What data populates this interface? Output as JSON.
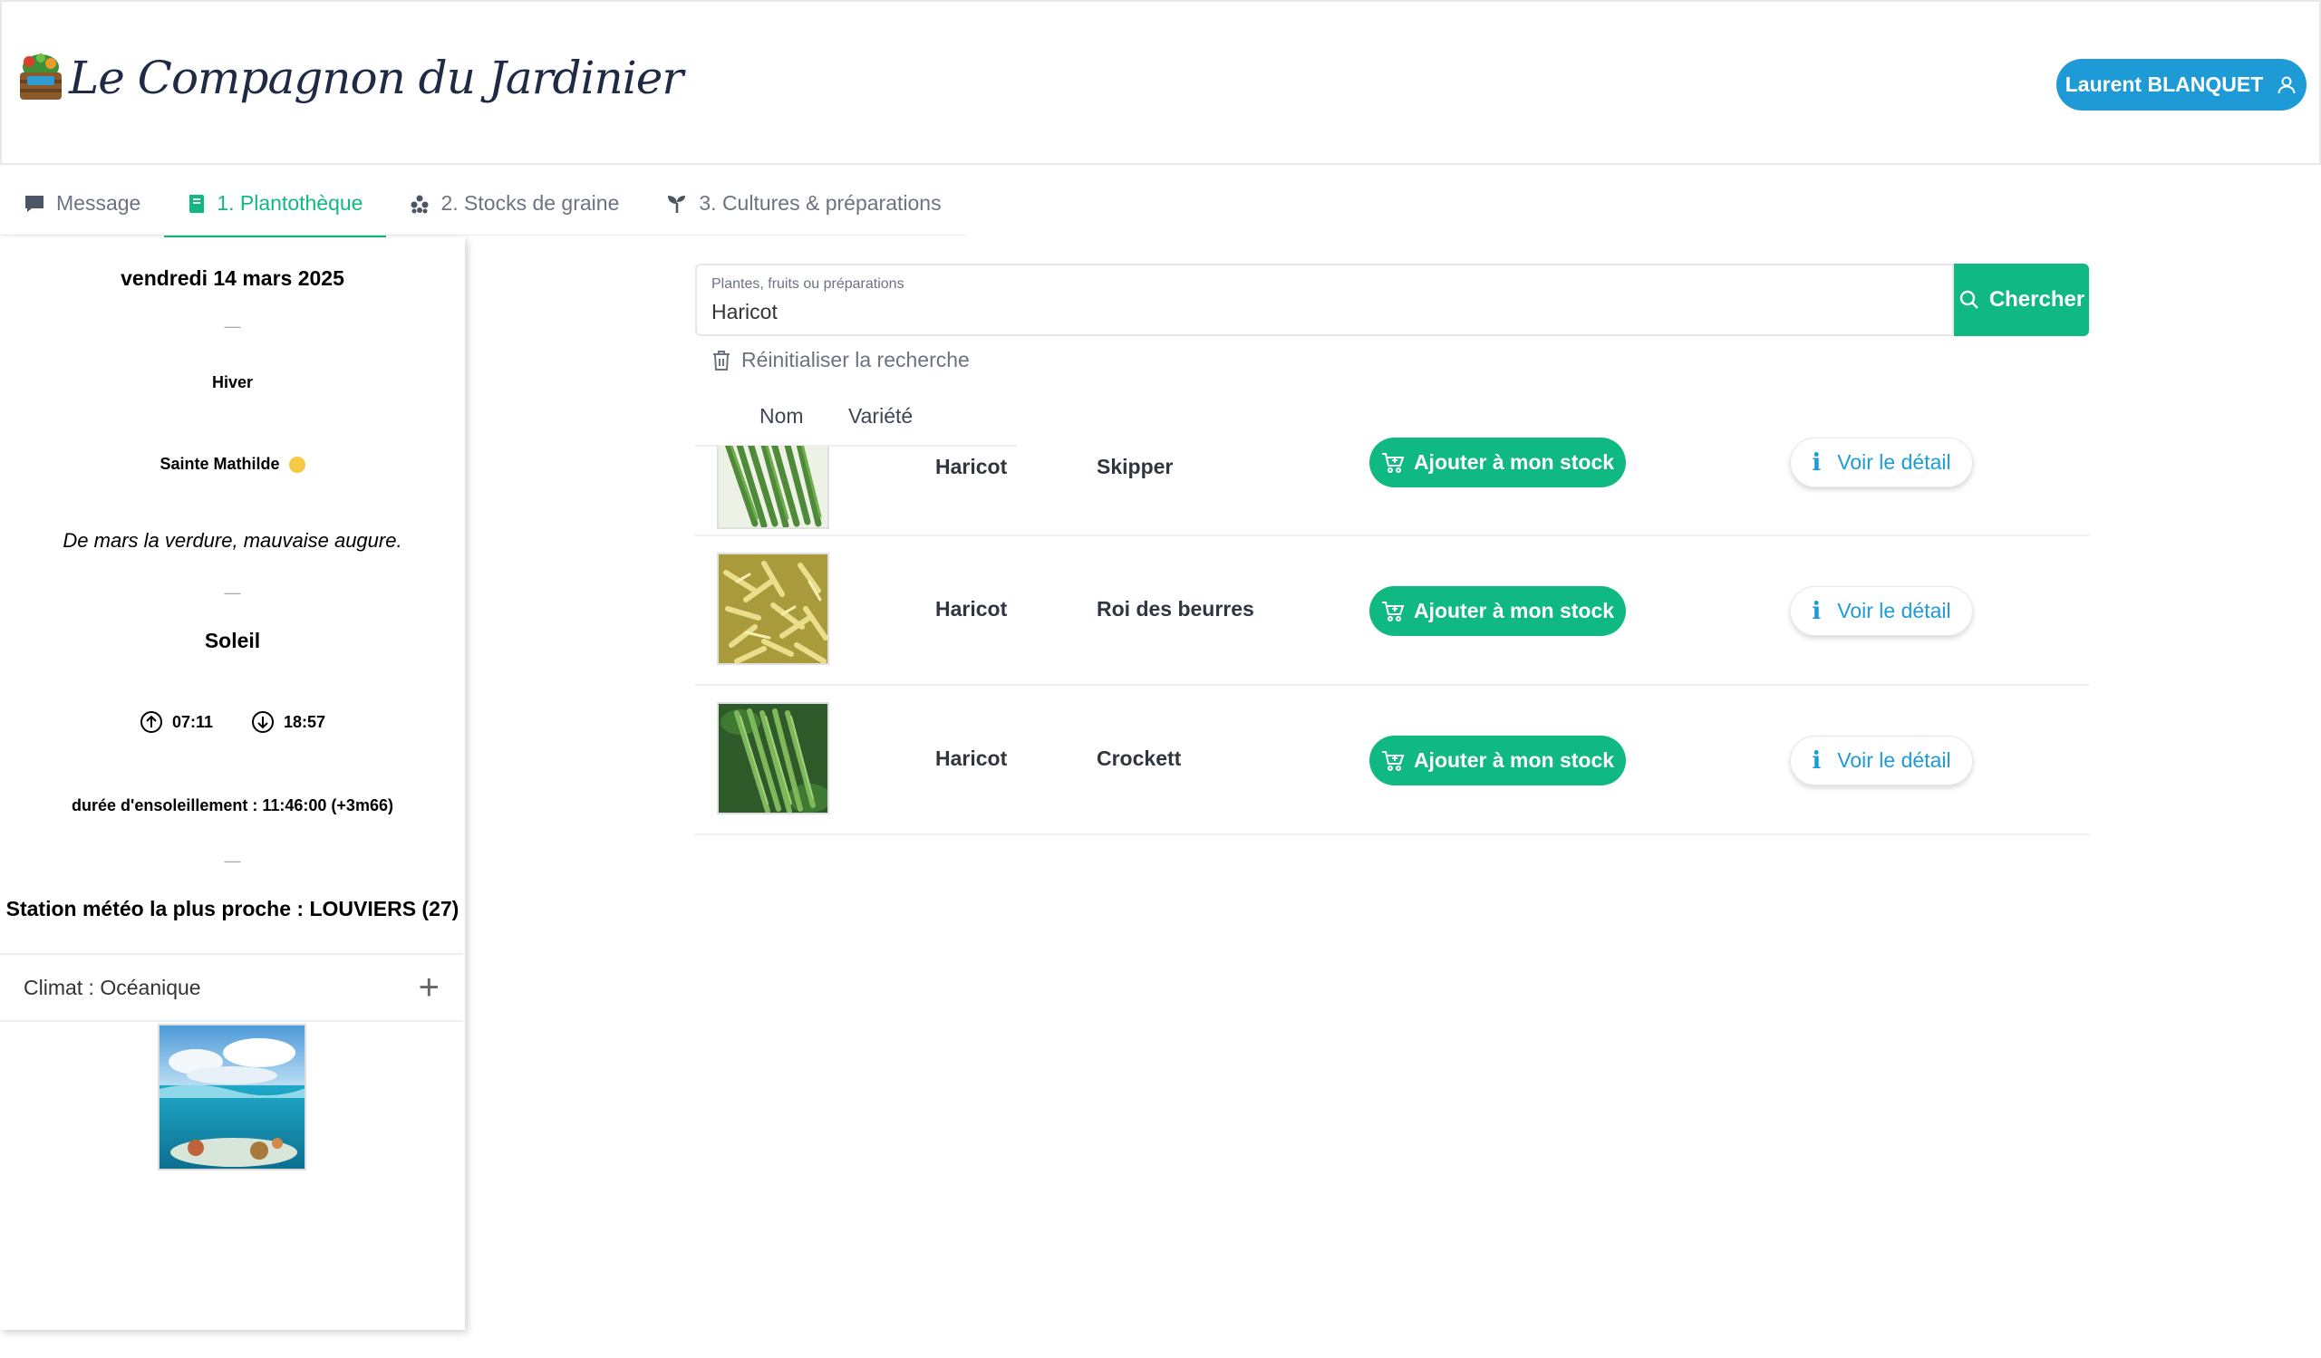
{
  "header": {
    "app_title": "Le Compagnon du Jardinier",
    "user_name": "Laurent BLANQUET"
  },
  "tabs": [
    {
      "label": "Message",
      "icon": "message-icon"
    },
    {
      "label": "1. Plantothèque",
      "icon": "book-icon",
      "active": true
    },
    {
      "label": "2. Stocks de graine",
      "icon": "seeds-icon"
    },
    {
      "label": "3. Cultures & préparations",
      "icon": "sprout-icon"
    }
  ],
  "sidebar": {
    "date": "vendredi 14 mars 2025",
    "separator": "—",
    "season": "Hiver",
    "saint": "Sainte Mathilde",
    "proverb": "De mars la verdure, mauvaise augure.",
    "sun_title": "Soleil",
    "sunrise": "07:11",
    "sunset": "18:57",
    "daylight": "durée d'ensoleillement : 11:46:00 (+3m66)",
    "station": "Station météo la plus proche : LOUVIERS (27)",
    "climate": "Climat : Océanique",
    "climate_toggle": "+"
  },
  "search": {
    "label": "Plantes, fruits ou préparations",
    "value": "Haricot",
    "button_label": "Chercher",
    "reset_label": "Réinitialiser la recherche"
  },
  "table": {
    "columns": [
      "Nom",
      "Variété"
    ],
    "add_label": "Ajouter à mon stock",
    "detail_label": "Voir le détail",
    "rows": [
      {
        "nom": "Haricot",
        "variete": "Skipper",
        "image": "green-beans"
      },
      {
        "nom": "Haricot",
        "variete": "Roi des beurres",
        "image": "yellow-beans"
      },
      {
        "nom": "Haricot",
        "variete": "Crockett",
        "image": "green-beans-leaves"
      }
    ]
  },
  "colors": {
    "primary_green": "#10b981",
    "primary_blue": "#1e9bd7",
    "saint_dot": "#f6c944"
  }
}
